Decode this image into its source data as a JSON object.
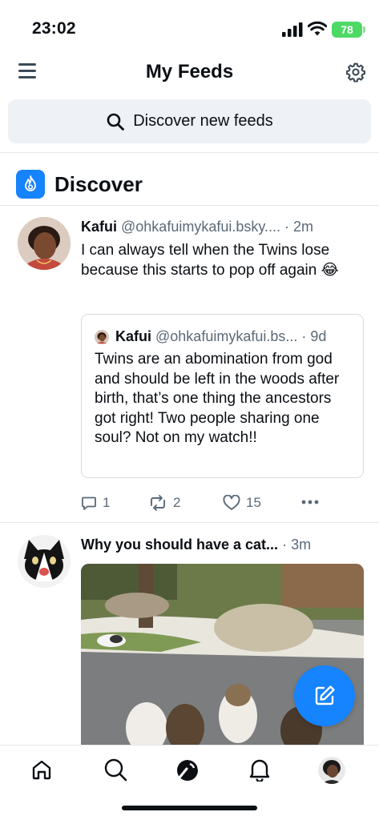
{
  "status_bar": {
    "time": "23:02",
    "battery": "78"
  },
  "header": {
    "title": "My Feeds"
  },
  "search": {
    "label": "Discover new feeds"
  },
  "section": {
    "title": "Discover"
  },
  "posts": [
    {
      "author": "Kafui",
      "handle": "@ohkafuimykafui.bsky....",
      "time": "· 2m",
      "text": "I can always tell when the Twins lose because this starts to pop off again 😂",
      "quote": {
        "author": "Kafui",
        "handle": "@ohkafuimykafui.bs...",
        "time": "· 9d",
        "text": "Twins are an abomination from god and should be left in the woods after birth, that’s one thing the ancestors got right! Two people sharing one soul? Not on my watch!!"
      },
      "replies": "1",
      "reposts": "2",
      "likes": "15"
    },
    {
      "title": "Why you should have a cat...",
      "time": "· 3m"
    }
  ],
  "colors": {
    "accent": "#1683ff",
    "battery": "#4cd964"
  }
}
